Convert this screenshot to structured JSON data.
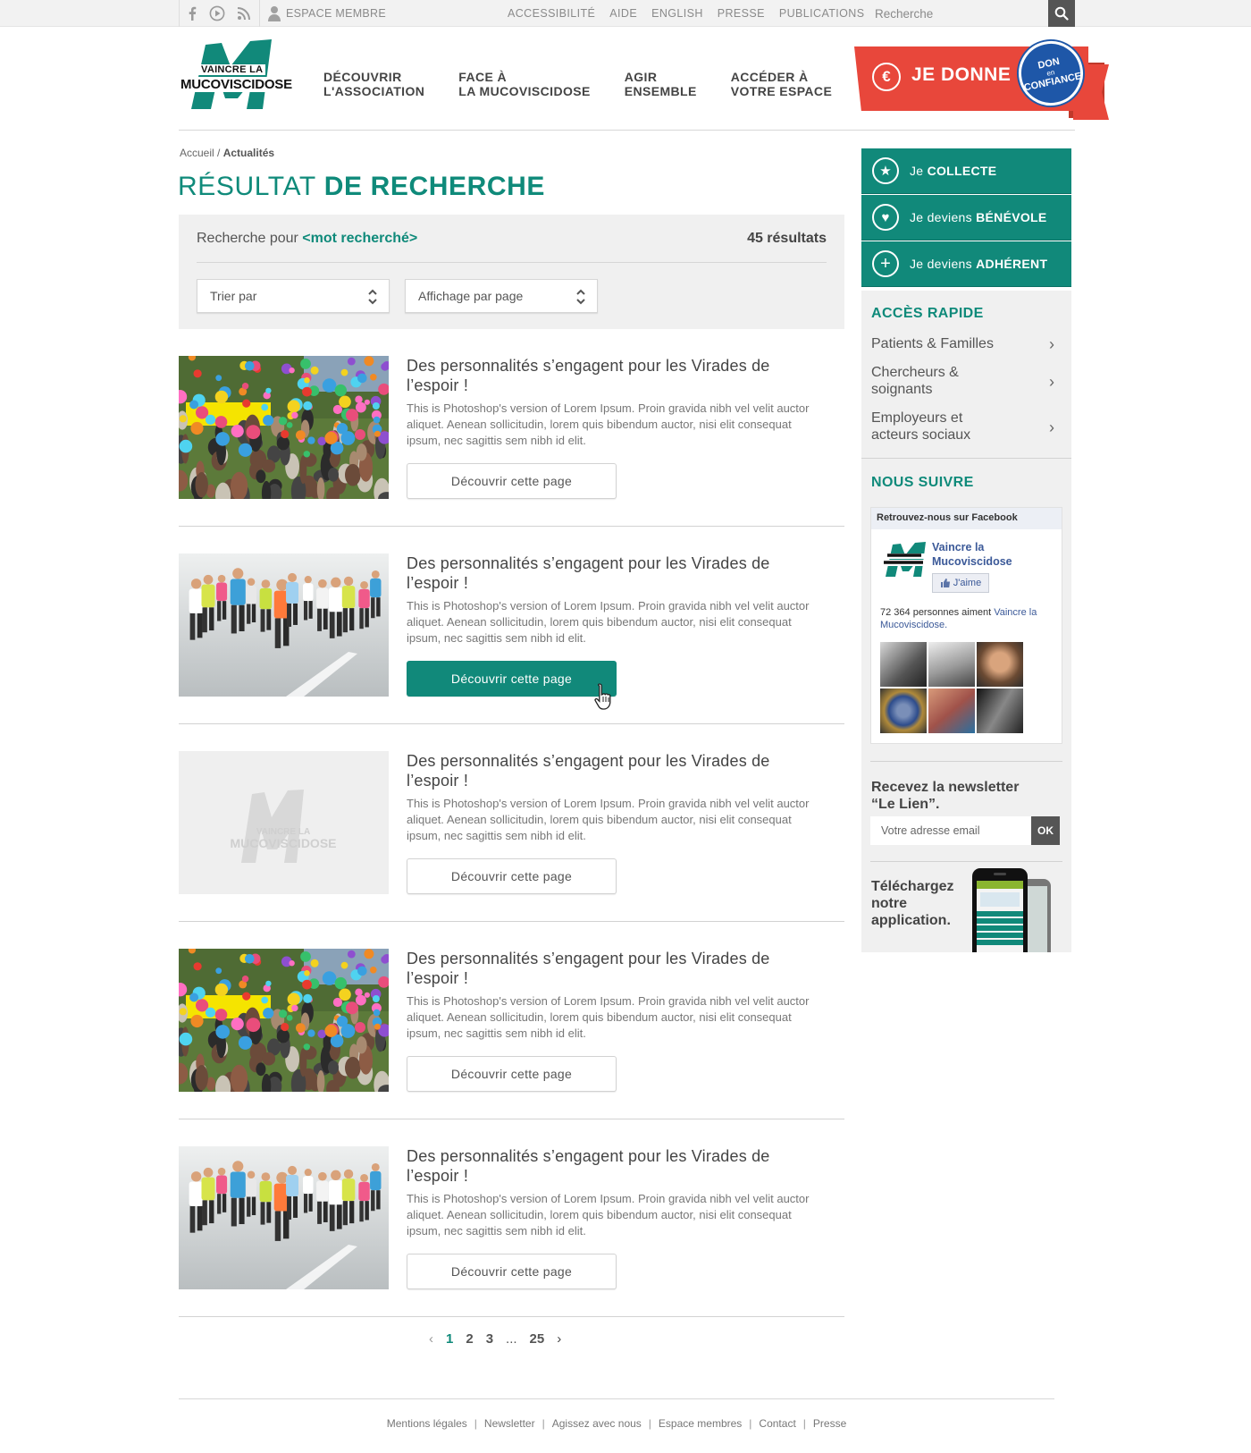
{
  "topbar": {
    "icons": [
      "facebook-icon",
      "play-icon",
      "rss-icon"
    ],
    "member_label": "ESPACE MEMBRE",
    "links": [
      "ACCESSIBILITÉ",
      "AIDE",
      "ENGLISH",
      "PRESSE",
      "PUBLICATIONS"
    ],
    "search_placeholder": "Recherche"
  },
  "header": {
    "logo_line1": "VAINCRE LA",
    "logo_line2": "MUCOVISCIDOSE",
    "nav": [
      {
        "line1": "DÉCOUVRIR",
        "line2": "L'ASSOCIATION"
      },
      {
        "line1": "FACE À",
        "line2": "LA MUCOVISCIDOSE"
      },
      {
        "line1": "AGIR",
        "line2": "ENSEMBLE"
      },
      {
        "line1": "ACCÉDER À",
        "line2": "VOTRE ESPACE"
      }
    ],
    "donate_label": "JE DONNE",
    "seal_line1": "DON",
    "seal_line2": "en",
    "seal_line3": "CONFIANCE"
  },
  "breadcrumb": {
    "home": "Accueil",
    "separator": " / ",
    "current": "Actualités"
  },
  "page_title": {
    "light": "RÉSULTAT",
    "bold": "DE RECHERCHE"
  },
  "search_panel": {
    "query_prefix": "Recherche pour",
    "keyword": "<mot recherché>",
    "result_count": "45 résultats",
    "sort_label": "Trier par",
    "per_page_label": "Affichage par page"
  },
  "results": [
    {
      "title": "Des personnalités s’engagent pour les Virades de l’espoir !",
      "desc": "This is Photoshop's version  of Lorem Ipsum. Proin gravida nibh vel velit auctor aliquet. Aenean sollicitudin, lorem quis bibendum auctor, nisi elit consequat ipsum, nec sagittis sem nibh id elit.",
      "button": "Découvrir cette page",
      "image": "balloons"
    },
    {
      "title": "Des personnalités s’engagent pour les Virades de l’espoir !",
      "desc": "This is Photoshop's version  of Lorem Ipsum. Proin gravida nibh vel velit auctor aliquet. Aenean sollicitudin, lorem quis bibendum auctor, nisi elit consequat ipsum, nec sagittis sem nibh id elit.",
      "button": "Découvrir cette page",
      "image": "runners"
    },
    {
      "title": "Des personnalités s’engagent pour les Virades de l’espoir !",
      "desc": "This is Photoshop's version  of Lorem Ipsum. Proin gravida nibh vel velit auctor aliquet. Aenean sollicitudin, lorem quis bibendum auctor, nisi elit consequat ipsum, nec sagittis sem nibh id elit.",
      "button": "Découvrir cette page",
      "image": "placeholder"
    },
    {
      "title": "Des personnalités s’engagent pour les Virades de l’espoir !",
      "desc": "This is Photoshop's version  of Lorem Ipsum. Proin gravida nibh vel velit auctor aliquet. Aenean sollicitudin, lorem quis bibendum auctor, nisi elit consequat ipsum, nec sagittis sem nibh id elit.",
      "button": "Découvrir cette page",
      "image": "balloons"
    },
    {
      "title": "Des personnalités s’engagent pour les Virades de l’espoir !",
      "desc": "This is Photoshop's version  of Lorem Ipsum. Proin gravida nibh vel velit auctor aliquet. Aenean sollicitudin, lorem quis bibendum auctor, nisi elit consequat ipsum, nec sagittis sem nibh id elit.",
      "button": "Découvrir cette page",
      "image": "runners"
    }
  ],
  "pagination": {
    "prev": "‹",
    "pages": [
      "1",
      "2",
      "3"
    ],
    "ellipsis": "...",
    "last": "25",
    "next": "›",
    "current": "1"
  },
  "footer": {
    "links": [
      "Mentions légales",
      "Newsletter",
      "Agissez avec nous",
      "Espace membres",
      "Contact",
      "Presse"
    ]
  },
  "sidebar": {
    "cta": [
      {
        "icon": "star-icon",
        "prefix": "Je ",
        "bold": "COLLECTE"
      },
      {
        "icon": "heart-icon",
        "prefix": "Je deviens ",
        "bold": "BÉNÉVOLE"
      },
      {
        "icon": "plus-icon",
        "prefix": "Je deviens ",
        "bold": "ADHÉRENT"
      }
    ],
    "quick_title": "ACCÈS RAPIDE",
    "quick_links": [
      {
        "line1": "Patients & Familles",
        "line2": ""
      },
      {
        "line1": "Chercheurs &",
        "line2": "soignants"
      },
      {
        "line1": "Employeurs et",
        "line2": "acteurs sociaux"
      }
    ],
    "follow_title": "NOUS SUIVRE",
    "facebook": {
      "header": "Retrouvez-nous sur Facebook",
      "page_name_line1": "Vaincre la",
      "page_name_line2": "Mucoviscidose",
      "like_label": "J'aime",
      "count_text": "72 364 personnes aiment",
      "count_link": "Vaincre la Mucoviscidose."
    },
    "newsletter_line1": "Recevez la newsletter",
    "newsletter_line2": "“Le Lien”.",
    "newsletter_placeholder": "Votre adresse email",
    "newsletter_ok": "OK",
    "app_line1": "Téléchargez",
    "app_line2": "notre",
    "app_line3": "application."
  },
  "colors": {
    "brand": "#11897a",
    "donate": "#e8473b",
    "seal": "#1e57a8",
    "facebook": "#3b5998"
  }
}
